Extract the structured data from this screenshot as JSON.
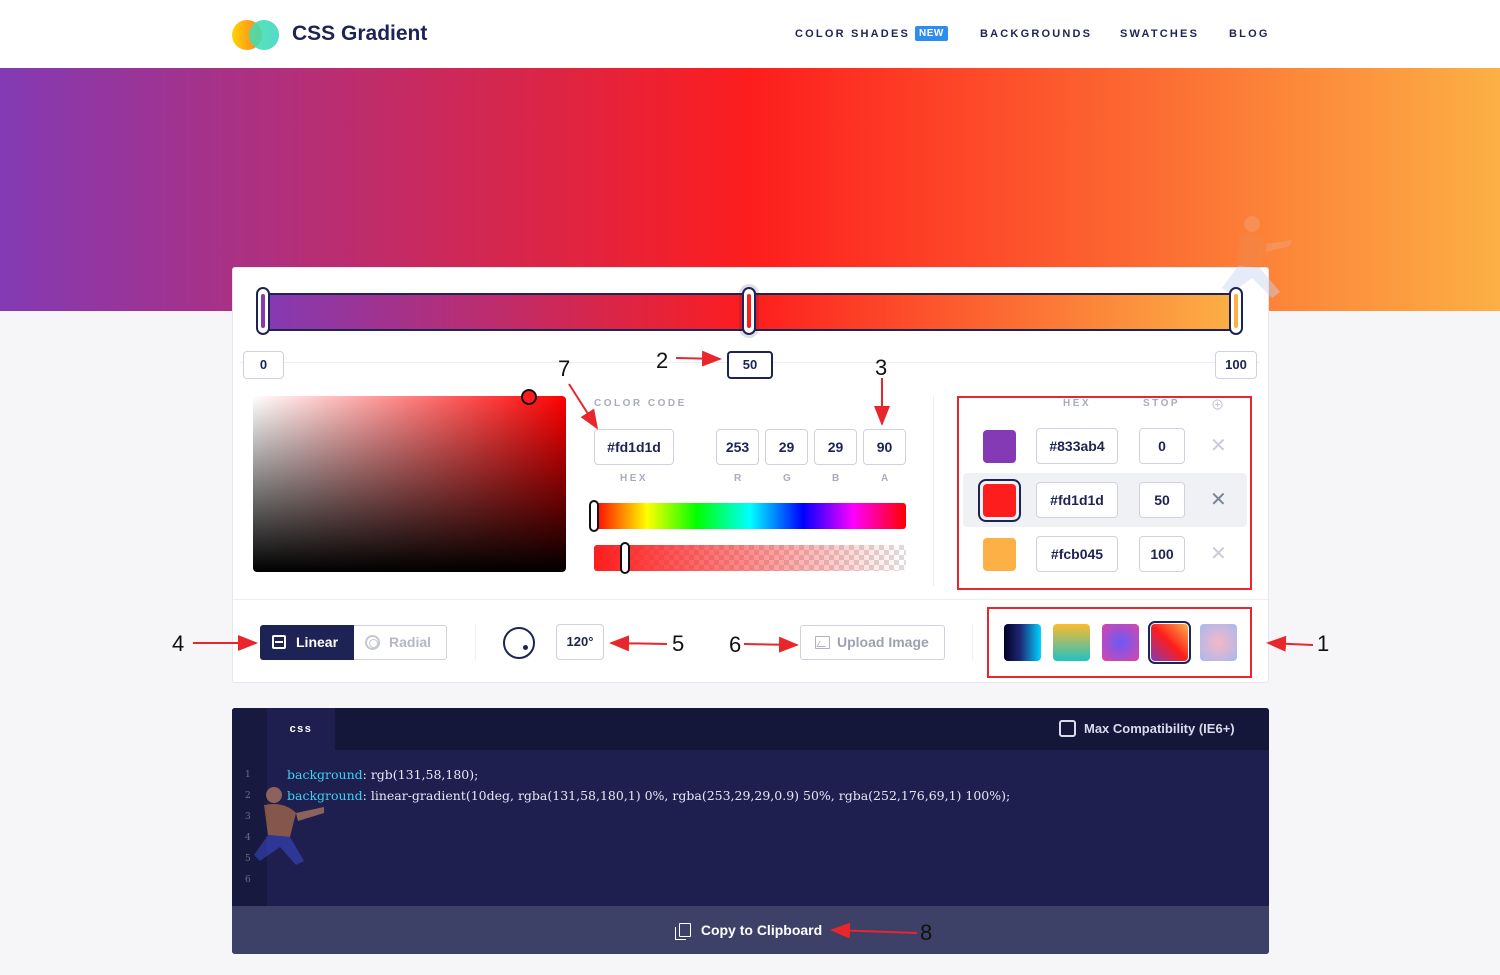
{
  "header": {
    "brand": "CSS Gradient",
    "nav": [
      {
        "label": "COLOR SHADES"
      },
      {
        "label": "BACKGROUNDS"
      },
      {
        "label": "SWATCHES"
      },
      {
        "label": "BLOG"
      }
    ],
    "new_badge": "NEW"
  },
  "gradient": {
    "css": "linear-gradient(90deg, #833ab4 0%, #fd1d1d 50%, #fcb045 100%)",
    "stop_positions": [
      "0",
      "50",
      "100"
    ],
    "active_stop": 1
  },
  "picker": {
    "color_code_label": "COLOR CODE",
    "hex_value": "#fd1d1d",
    "hex_caption": "HEX",
    "r": "253",
    "g": "29",
    "b": "29",
    "a": "90",
    "r_label": "R",
    "g_label": "G",
    "b_label": "B",
    "a_label": "A"
  },
  "stops_table": {
    "hex_header": "HEX",
    "stop_header": "STOP",
    "add_icon": "plus-circle-icon",
    "rows": [
      {
        "color": "#833ab4",
        "hex": "#833ab4",
        "stop": "0"
      },
      {
        "color": "#fd1d1d",
        "hex": "#fd1d1d",
        "stop": "50"
      },
      {
        "color": "#fcb045",
        "hex": "#fcb045",
        "stop": "100"
      }
    ],
    "delete_glyph": "✕"
  },
  "controls": {
    "linear_label": "Linear",
    "radial_label": "Radial",
    "angle_value": "120°",
    "upload_label": "Upload Image"
  },
  "presets": [
    {
      "name": "preset-1",
      "css": "linear-gradient(90deg, #020024, #1e2a78 45%, #00d4ff)"
    },
    {
      "name": "preset-2",
      "css": "linear-gradient(180deg, #fdbb2d, #22c1c3)"
    },
    {
      "name": "preset-3",
      "css": "radial-gradient(circle, #6a5af9 0%, #d946a8 100%)"
    },
    {
      "name": "preset-4",
      "css": "linear-gradient(45deg, #833ab4, #fd1d1d 50%, #fcb045)"
    },
    {
      "name": "preset-5",
      "css": "radial-gradient(circle, #f5b7c5 0%, #a8b8f0 100%)"
    }
  ],
  "code": {
    "tab_label": "css",
    "max_compat_label": "Max Compatibility (IE6+)",
    "line_numbers": [
      "1",
      "2",
      "3",
      "4",
      "5",
      "6"
    ],
    "line1_prop": "background",
    "line1_value": ": rgb(131,58,180);",
    "line2_prop": "background",
    "line2_value": ": linear-gradient(10deg, rgba(131,58,180,1) 0%, rgba(253,29,29,0.9) 50%, rgba(252,176,69,1) 100%);",
    "copy_label": "Copy to Clipboard"
  },
  "annotations": {
    "n1": "1",
    "n2": "2",
    "n3": "3",
    "n4": "4",
    "n5": "5",
    "n6": "6",
    "n7": "7",
    "n8": "8",
    "frame_color": "#e8262b"
  }
}
